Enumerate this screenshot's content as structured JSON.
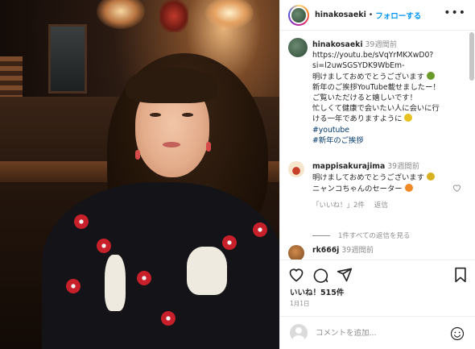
{
  "header": {
    "username": "hinakosaeki",
    "separator": "•",
    "follow_label": "フォローする",
    "more_icon": "more-horizontal-icon"
  },
  "caption": {
    "username": "hinakosaeki",
    "time": "39週間前",
    "lines": [
      "https://youtu.be/sVqYrMKXwD0?",
      "si=l2uwSGSYDK9WbEm-",
      "明けましておめでとうございます",
      "新年のご挨拶YouTube載せましたー！",
      "ご覧いただけると嬉しいです！",
      "忙しくて健康で会いたい人に会いに行",
      "ける一年でありますように"
    ],
    "hashtags": [
      "#youtube",
      "#新年のご挨拶"
    ]
  },
  "comments": [
    {
      "username": "mappisakurajima",
      "time": "39週間前",
      "lines": [
        "明けましておめでとうございます",
        "ニャンコちゃんのセーター"
      ],
      "likes_label": "「いいね！」2件",
      "reply_label": "返信",
      "view_replies_label": "1件すべての返信を見る"
    },
    {
      "username": "rk666j",
      "time": "39週間前"
    }
  ],
  "likes": "いいね！515件",
  "date": "1月1日",
  "add_comment": {
    "placeholder": "コメントを追加..."
  },
  "colors": {
    "link": "#0095f6",
    "hashtag": "#00376b",
    "muted": "#8e8e8e",
    "text": "#262626"
  }
}
